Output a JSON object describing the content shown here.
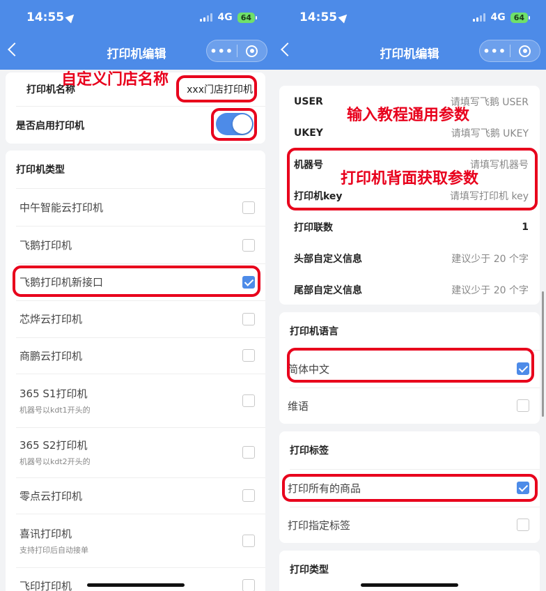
{
  "status": {
    "time": "14:55",
    "network": "4G",
    "battery": "64"
  },
  "nav": {
    "title": "打印机编辑",
    "more": "•••"
  },
  "left": {
    "printer_name_label": "打印机名称",
    "printer_name_value": "xxx门店打印机",
    "enable_label": "是否启用打印机",
    "printer_type_title": "打印机类型",
    "types": [
      {
        "label": "中午智能云打印机",
        "sub": "",
        "checked": false
      },
      {
        "label": "飞鹅打印机",
        "sub": "",
        "checked": false
      },
      {
        "label": "飞鹅打印机新接口",
        "sub": "",
        "checked": true
      },
      {
        "label": "芯烨云打印机",
        "sub": "",
        "checked": false
      },
      {
        "label": "商鹏云打印机",
        "sub": "",
        "checked": false
      },
      {
        "label": "365 S1打印机",
        "sub": "机器号以kdt1开头的",
        "checked": false
      },
      {
        "label": "365 S2打印机",
        "sub": "机器号以kdt2开头的",
        "checked": false
      },
      {
        "label": "零点云打印机",
        "sub": "",
        "checked": false
      },
      {
        "label": "喜讯打印机",
        "sub": "支持打印后自动接单",
        "checked": false
      },
      {
        "label": "飞印打印机",
        "sub": "",
        "checked": false
      }
    ],
    "annotation": "自定义门店名称"
  },
  "right": {
    "fields": [
      {
        "label": "USER",
        "value": "请填写飞鹅 USER"
      },
      {
        "label": "UKEY",
        "value": "请填写飞鹅 UKEY"
      },
      {
        "label": "机器号",
        "value": "请填写机器号"
      },
      {
        "label": "打印机key",
        "value": "请填写打印机 key"
      },
      {
        "label": "打印联数",
        "value": "1"
      },
      {
        "label": "头部自定义信息",
        "value": "建议少于 20 个字"
      },
      {
        "label": "尾部自定义信息",
        "value": "建议少于 20 个字"
      }
    ],
    "language_title": "打印机语言",
    "languages": [
      {
        "label": "简体中文",
        "checked": true
      },
      {
        "label": "维语",
        "checked": false
      }
    ],
    "label_title": "打印标签",
    "labels": [
      {
        "label": "打印所有的商品",
        "checked": true
      },
      {
        "label": "打印指定标签",
        "checked": false
      }
    ],
    "print_type_title": "打印类型",
    "annotation_1": "输入教程通用参数",
    "annotation_2": "打印机背面获取参数"
  },
  "colors": {
    "header": "#4d8be8",
    "annotation": "#e8001c"
  }
}
